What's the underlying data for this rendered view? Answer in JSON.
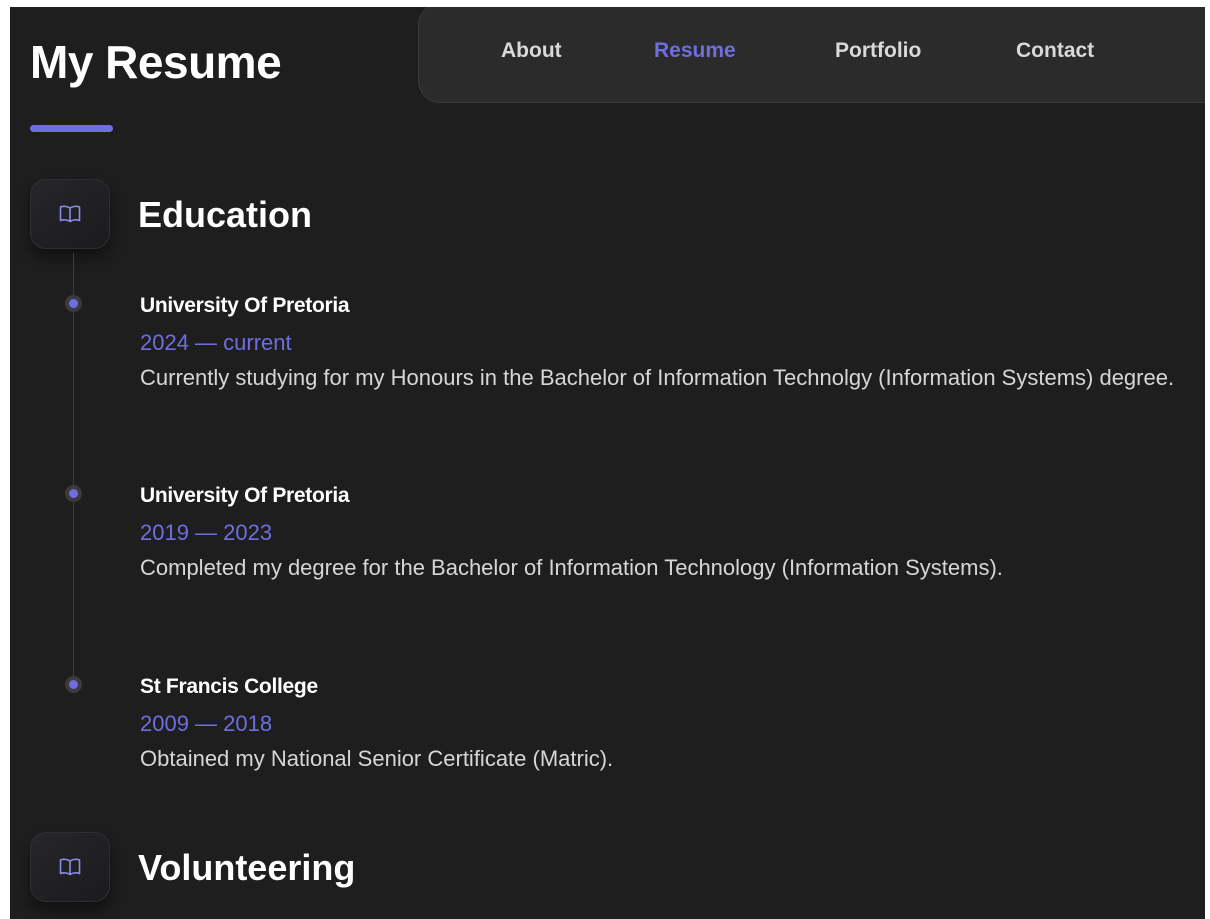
{
  "page": {
    "title": "My Resume"
  },
  "nav": {
    "items": [
      {
        "label": "About",
        "active": false
      },
      {
        "label": "Resume",
        "active": true
      },
      {
        "label": "Portfolio",
        "active": false
      },
      {
        "label": "Contact",
        "active": false
      }
    ]
  },
  "sections": {
    "education": {
      "title": "Education",
      "icon": "book-icon",
      "entries": [
        {
          "title": "University Of Pretoria",
          "date": "2024 — current",
          "description": "Currently studying for my Honours in the Bachelor of Information Technolgy (Information Systems) degree."
        },
        {
          "title": "University Of Pretoria",
          "date": "2019 — 2023",
          "description": "Completed my degree for the Bachelor of Information Technology (Information Systems)."
        },
        {
          "title": "St Francis College",
          "date": "2009 — 2018",
          "description": "Obtained my National Senior Certificate (Matric)."
        }
      ]
    },
    "volunteering": {
      "title": "Volunteering",
      "icon": "book-icon"
    }
  },
  "colors": {
    "accent": "#6f6ee0",
    "background": "#1e1e1f",
    "navbar": "#2b2b2c",
    "text": "#ffffff",
    "muted_text": "#d6d6d6"
  }
}
